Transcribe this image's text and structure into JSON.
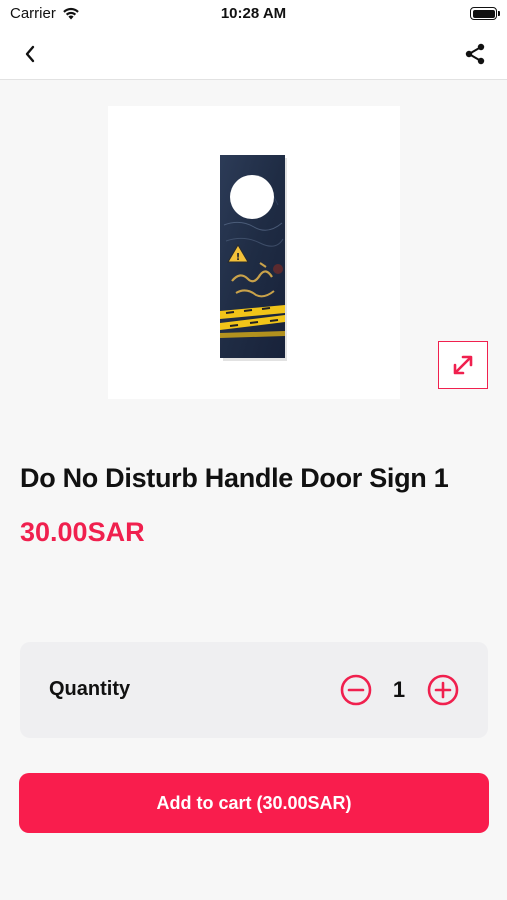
{
  "status_bar": {
    "carrier": "Carrier",
    "time": "10:28 AM",
    "icons": [
      "wifi-icon",
      "battery-icon"
    ]
  },
  "nav": {
    "icons": [
      "chevron-left-icon",
      "share-icon"
    ]
  },
  "product": {
    "title": "Do No Disturb Handle Door Sign 1",
    "price": "30.00SAR",
    "image_icon": "expand-icon"
  },
  "quantity": {
    "label": "Quantity",
    "value": "1",
    "icons": [
      "minus-circle-icon",
      "plus-circle-icon"
    ]
  },
  "cart": {
    "button_label": "Add to cart (30.00SAR)"
  },
  "colors": {
    "accent": "#f0204e",
    "button": "#f91d4d",
    "background": "#f7f7f7",
    "card": "#efeff1"
  }
}
